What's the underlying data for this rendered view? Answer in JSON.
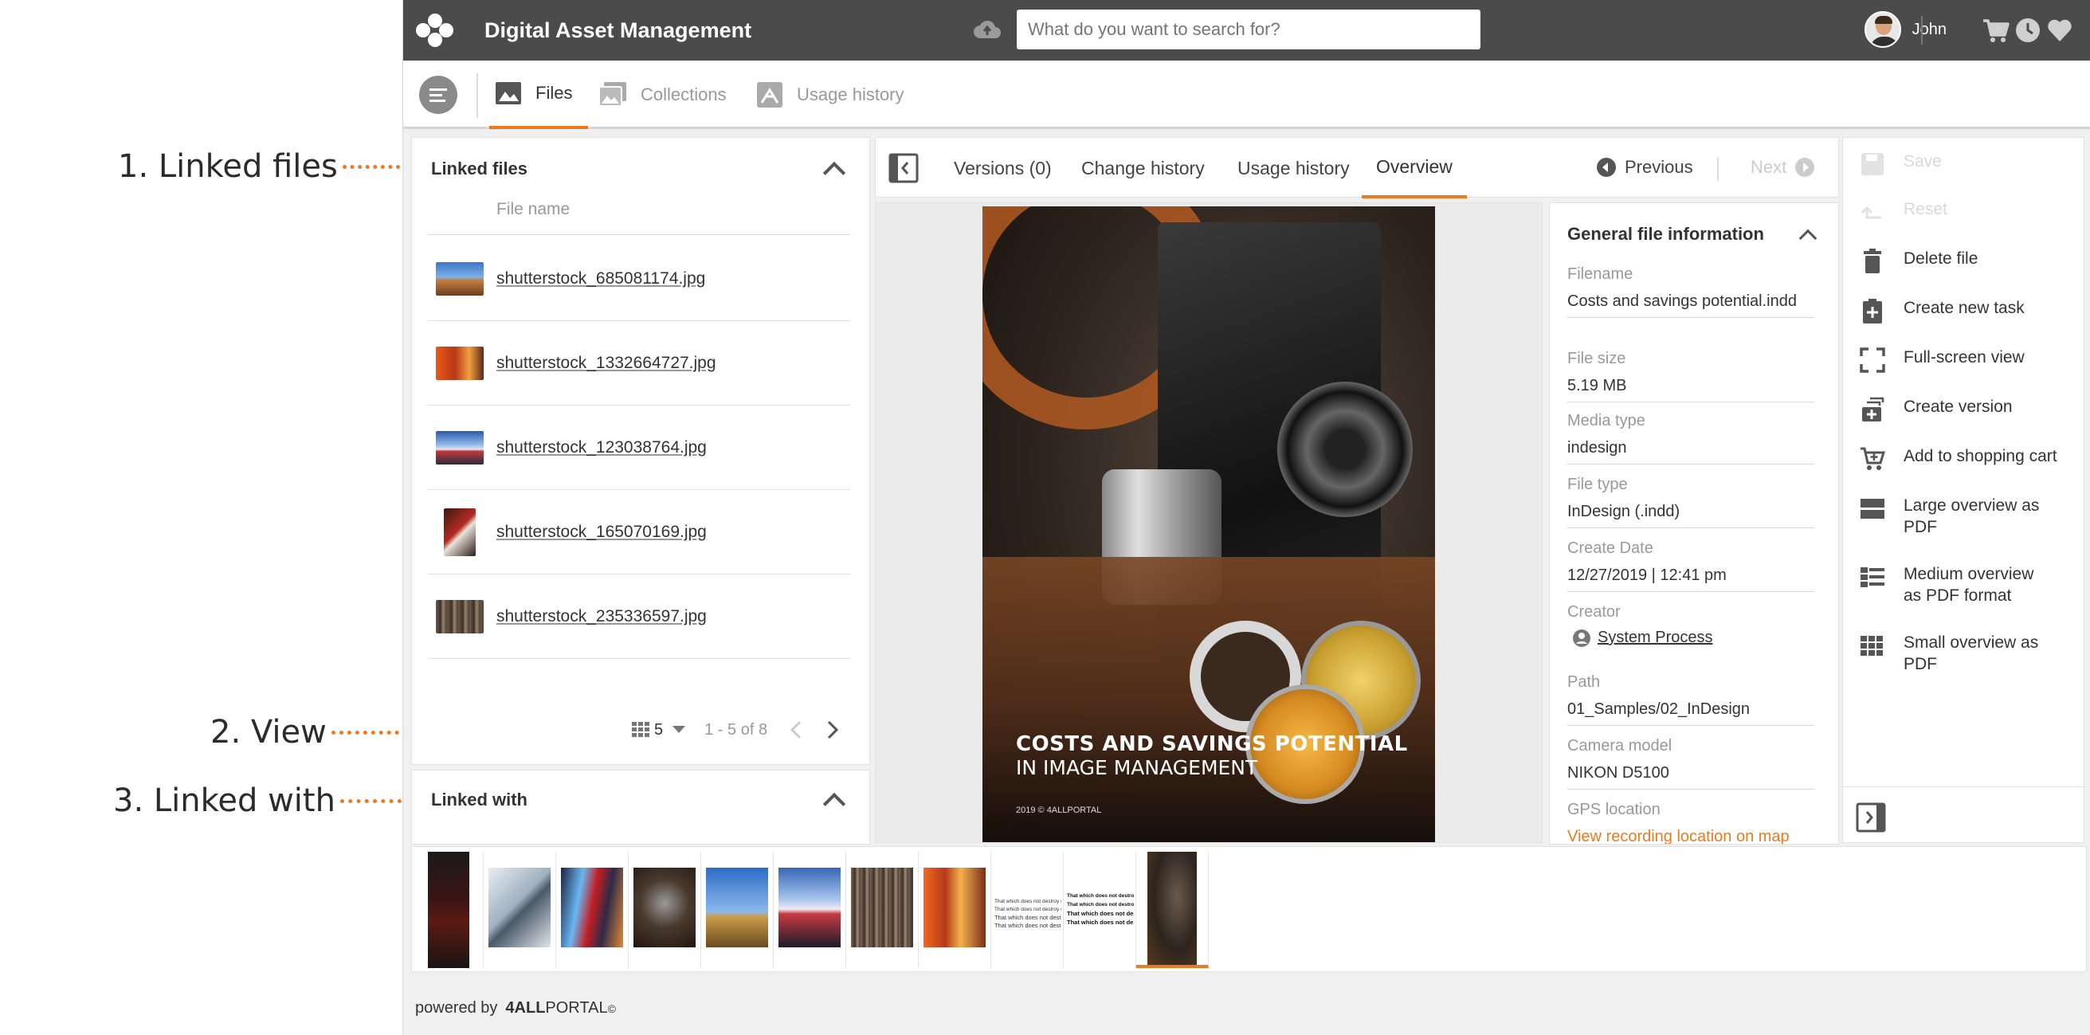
{
  "annotations": [
    {
      "label": "1. Linked files"
    },
    {
      "label": "2. View"
    },
    {
      "label": "3. Linked with"
    }
  ],
  "topbar": {
    "title": "Digital Asset Management",
    "search_placeholder": "What do you want to search for?",
    "user_name": "John",
    "icons": [
      "upload-cloud-icon",
      "shopping-cart-icon",
      "clock-icon",
      "heart-icon"
    ]
  },
  "nav": {
    "tabs": [
      {
        "label": "Files",
        "icon": "image-icon",
        "active": true
      },
      {
        "label": "Collections",
        "icon": "collections-icon",
        "active": false
      },
      {
        "label": "Usage history",
        "icon": "usage-icon",
        "active": false
      }
    ]
  },
  "linked_files": {
    "title": "Linked files",
    "column_header": "File name",
    "files": [
      {
        "name": "shutterstock_685081174.jpg"
      },
      {
        "name": "shutterstock_1332664727.jpg"
      },
      {
        "name": "shutterstock_123038764.jpg"
      },
      {
        "name": "shutterstock_165070169.jpg"
      },
      {
        "name": "shutterstock_235336597.jpg"
      }
    ],
    "page_size": "5",
    "range": "1 - 5 of 8"
  },
  "linked_with": {
    "title": "Linked with"
  },
  "center_tabs": {
    "tabs": [
      {
        "label": "Versions (0)",
        "active": false
      },
      {
        "label": "Change history",
        "active": false
      },
      {
        "label": "Usage history",
        "active": false
      },
      {
        "label": "Overview",
        "active": true
      }
    ],
    "previous": "Previous",
    "next": "Next"
  },
  "preview": {
    "headline": "COSTS AND SAVINGS POTENTIAL",
    "subline": "IN IMAGE MANAGEMENT",
    "footer": "2019 © 4ALLPORTAL"
  },
  "file_info": {
    "title": "General file information",
    "fields": [
      {
        "label": "Filename",
        "value": "Costs and savings potential.indd"
      },
      {
        "label": "File size",
        "value": "5.19 MB"
      },
      {
        "label": "Media type",
        "value": "indesign"
      },
      {
        "label": "File type",
        "value": "InDesign (.indd)"
      },
      {
        "label": "Create Date",
        "value": "12/27/2019 | 12:41 pm"
      },
      {
        "label": "Creator",
        "value": "System Process"
      },
      {
        "label": "Path",
        "value": "01_Samples/02_InDesign"
      },
      {
        "label": "Camera model",
        "value": "NIKON D5100"
      },
      {
        "label": "GPS location",
        "value": "View recording location on map"
      }
    ]
  },
  "actions": [
    {
      "label": "Save",
      "icon": "save-icon",
      "disabled": true
    },
    {
      "label": "Reset",
      "icon": "reset-icon",
      "disabled": true
    },
    {
      "label": "Delete file",
      "icon": "trash-icon",
      "disabled": false
    },
    {
      "label": "Create new task",
      "icon": "clipboard-plus-icon",
      "disabled": false
    },
    {
      "label": "Full-screen view",
      "icon": "fullscreen-icon",
      "disabled": false
    },
    {
      "label": "Create version",
      "icon": "version-icon",
      "disabled": false
    },
    {
      "label": "Add to shopping cart",
      "icon": "cart-add-icon",
      "disabled": false
    },
    {
      "label": "Large overview as PDF",
      "icon": "large-overview-icon",
      "disabled": false
    },
    {
      "label": "Medium overview as PDF format",
      "icon": "medium-overview-icon",
      "disabled": false
    },
    {
      "label": "Small overview as PDF",
      "icon": "small-overview-icon",
      "disabled": false
    }
  ],
  "doc_thumb_lines": [
    "That which does not destroy me, only makes me...",
    "That which does not destroy me, only makes me",
    "That which does not destroy me",
    "That which does not dest"
  ],
  "footer": {
    "powered_by": "powered by",
    "brand_bold": "4ALL",
    "brand_rest": "PORTAL",
    "reg": "©"
  },
  "colors": {
    "accent": "#ee7a1f",
    "topbar": "#4b4b4b",
    "background": "#f0f0f0"
  }
}
